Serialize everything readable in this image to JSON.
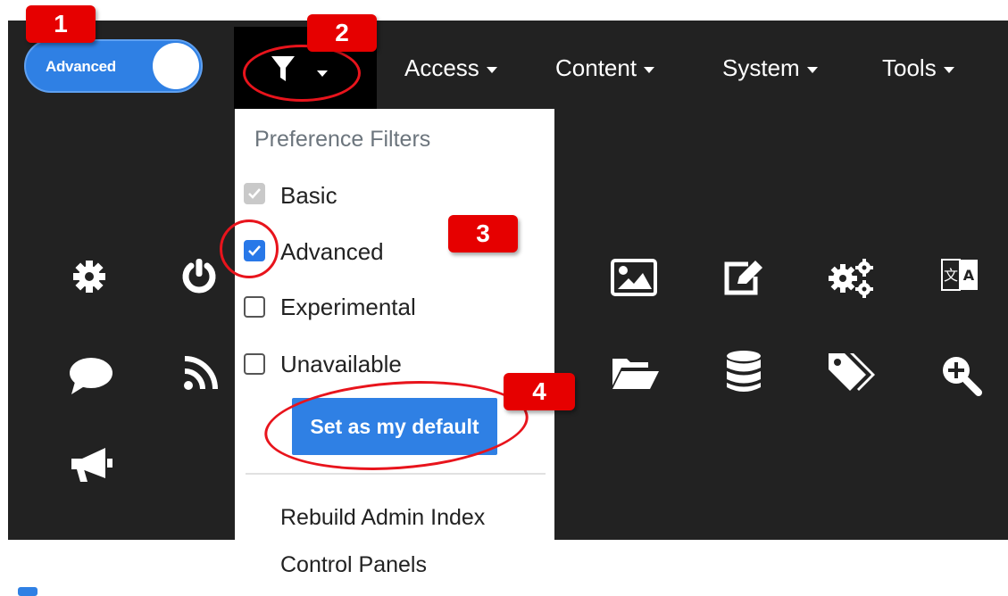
{
  "toggle": {
    "label": "Advanced",
    "state": "on"
  },
  "navbar": {
    "menus": [
      {
        "label": "Access"
      },
      {
        "label": "Content"
      },
      {
        "label": "System"
      },
      {
        "label": "Tools"
      }
    ]
  },
  "dropdown": {
    "header": "Preference Filters",
    "options": [
      {
        "label": "Basic",
        "checked": true,
        "disabled": true
      },
      {
        "label": "Advanced",
        "checked": true,
        "disabled": false
      },
      {
        "label": "Experimental",
        "checked": false,
        "disabled": false
      },
      {
        "label": "Unavailable",
        "checked": false,
        "disabled": false
      }
    ],
    "default_button": "Set as my default",
    "links": [
      "Rebuild Admin Index",
      "Control Panels"
    ]
  },
  "grid_icons": [
    "gear-icon",
    "power-icon",
    "image-icon",
    "edit-icon",
    "cogs-icon",
    "language-icon",
    "comment-icon",
    "rss-icon",
    "folder-open-icon",
    "database-icon",
    "tags-icon",
    "search-plus-icon",
    "bullhorn-icon"
  ],
  "annotations": [
    "1",
    "2",
    "3",
    "4"
  ],
  "colors": {
    "navbar": "#222222",
    "accent": "#2f80e4",
    "annotation": "#e60000"
  }
}
